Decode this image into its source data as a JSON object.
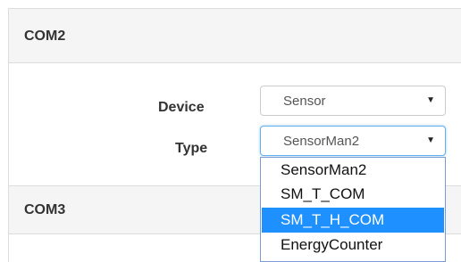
{
  "sections": {
    "com2_title": "COM2",
    "com3_title": "COM3"
  },
  "form": {
    "device_label": "Device",
    "device_value": "Sensor",
    "type_label": "Type",
    "type_value": "SensorMan2"
  },
  "dropdown": {
    "options": [
      "SensorMan2",
      "SM_T_COM",
      "SM_T_H_COM",
      "EnergyCounter"
    ],
    "highlighted_index": 2
  },
  "colors": {
    "highlight": "#1e90ff",
    "header_bg": "#f5f5f5"
  },
  "icons": {
    "select_arrow": "▼"
  }
}
